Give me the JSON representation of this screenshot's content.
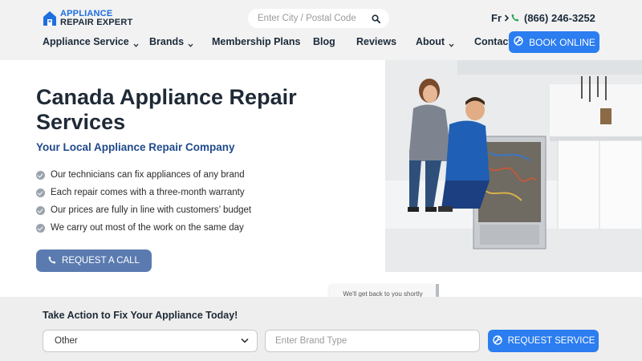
{
  "header": {
    "logo_line1": "APPLIANCE",
    "logo_line2": "REPAIR EXPERT",
    "search_placeholder": "Enter City / Postal Code",
    "lang_label": "Fr",
    "phone": "(866) 246-3252",
    "book_label": "BOOK ONLINE"
  },
  "nav": {
    "items": [
      {
        "label": "Appliance Service",
        "dropdown": true
      },
      {
        "label": "Brands",
        "dropdown": true
      },
      {
        "label": "Membership Plans",
        "dropdown": false
      },
      {
        "label": "Blog",
        "dropdown": false
      },
      {
        "label": "Reviews",
        "dropdown": false
      },
      {
        "label": "About",
        "dropdown": true
      },
      {
        "label": "Contact",
        "dropdown": false
      }
    ]
  },
  "hero": {
    "title": "Canada Appliance Repair Services",
    "subtitle": "Your Local Appliance Repair Company",
    "features": [
      "Our technicians can fix appliances of any brand",
      "Each repair comes with a three-month warranty",
      "Our prices are fully in line with customers’ budget",
      "We carry out most of the work on the same day"
    ],
    "call_label": "REQUEST A CALL"
  },
  "tooltip": "We'll get back to you shortly",
  "action": {
    "title": "Take Action to Fix Your Appliance Today!",
    "select_value": "Other",
    "brand_placeholder": "Enter Brand Type",
    "request_label": "REQUEST SERVICE"
  },
  "colors": {
    "accent": "#2b7df0",
    "call_button": "#5b7bb0",
    "header_bg": "#f2f2f2",
    "title_text": "#1f2a36",
    "subtitle_text": "#1f4a8a"
  }
}
